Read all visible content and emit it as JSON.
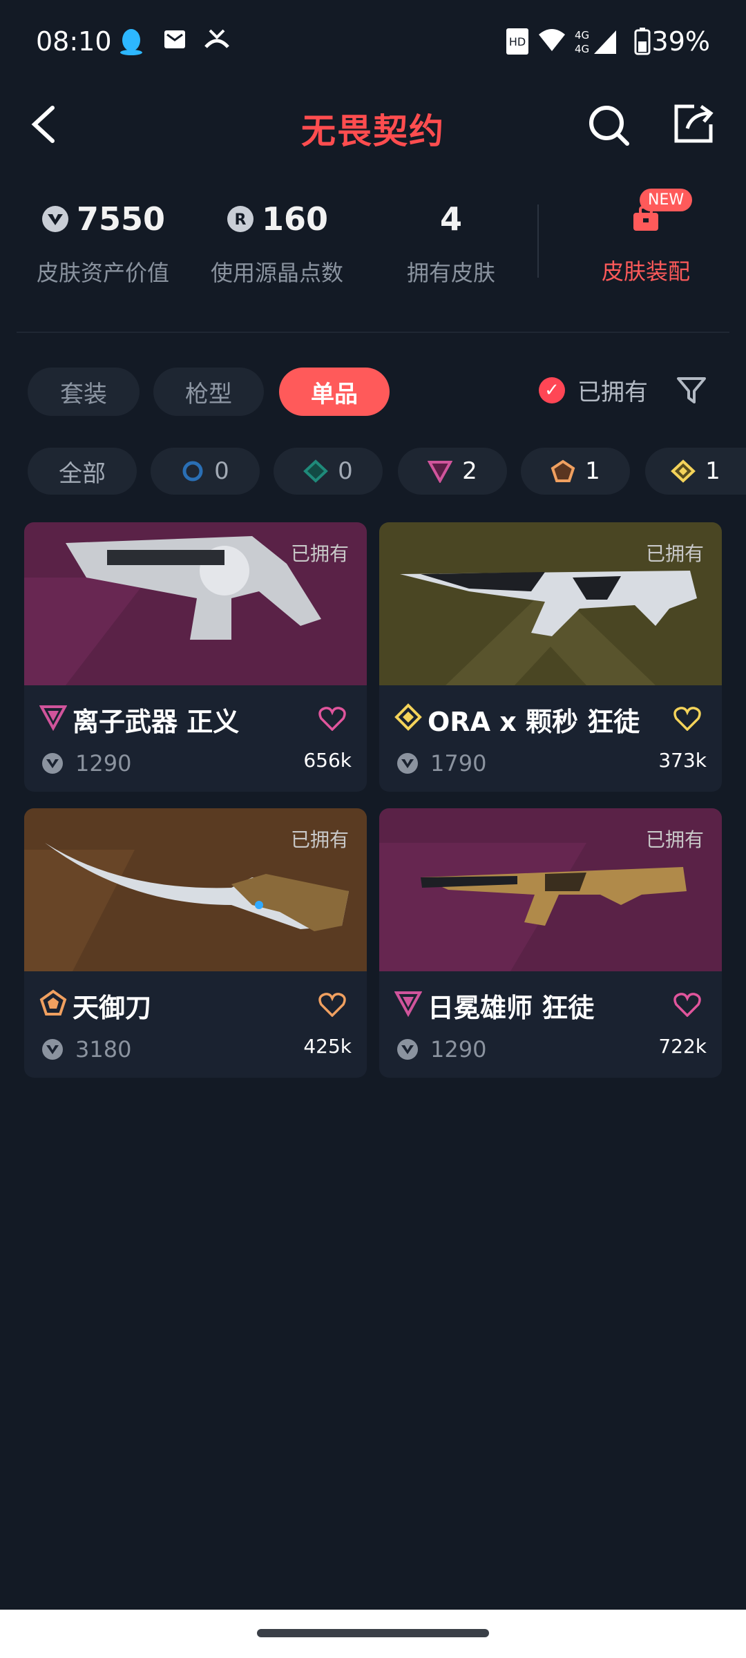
{
  "status_bar": {
    "time": "08:10",
    "battery": "39%"
  },
  "header": {
    "title": "无畏契约"
  },
  "stats": [
    {
      "value": "7550",
      "label": "皮肤资产价值",
      "icon": "vp-coin-icon"
    },
    {
      "value": "160",
      "label": "使用源晶点数",
      "icon": "radianite-icon"
    },
    {
      "value": "4",
      "label": "拥有皮肤",
      "icon": ""
    }
  ],
  "outfit": {
    "label": "皮肤装配",
    "badge": "NEW"
  },
  "tabs": [
    {
      "label": "套装",
      "active": false
    },
    {
      "label": "枪型",
      "active": false
    },
    {
      "label": "单品",
      "active": true
    }
  ],
  "owned_filter": {
    "label": "已拥有",
    "checked": true
  },
  "tiers": [
    {
      "label": "全部",
      "count": ""
    },
    {
      "label": "select",
      "count": "0",
      "color": "#2a6fb5"
    },
    {
      "label": "deluxe",
      "count": "0",
      "color": "#1f8a7a"
    },
    {
      "label": "premium",
      "count": "2",
      "color": "#d0549b"
    },
    {
      "label": "exclusive",
      "count": "1",
      "color": "#f0a060"
    },
    {
      "label": "ultra",
      "count": "1",
      "color": "#f4d35a"
    }
  ],
  "cards": [
    {
      "name": "离子武器 正义",
      "price": "1290",
      "likes": "656k",
      "owned": "已拥有",
      "tier_color": "#d0549b",
      "heart_color": "#e0559c",
      "bg": "#5a2247"
    },
    {
      "name": "ORA x 颗秒 狂徒",
      "price": "1790",
      "likes": "373k",
      "owned": "已拥有",
      "tier_color": "#f4d35a",
      "heart_color": "#f4d35a",
      "bg": "#4a4623"
    },
    {
      "name": "天御刀",
      "price": "3180",
      "likes": "425k",
      "owned": "已拥有",
      "tier_color": "#f0a060",
      "heart_color": "#f0a060",
      "bg": "#5a3b22"
    },
    {
      "name": "日冕雄师 狂徒",
      "price": "1290",
      "likes": "722k",
      "owned": "已拥有",
      "tier_color": "#d0549b",
      "heart_color": "#e0559c",
      "bg": "#5a2247"
    }
  ]
}
